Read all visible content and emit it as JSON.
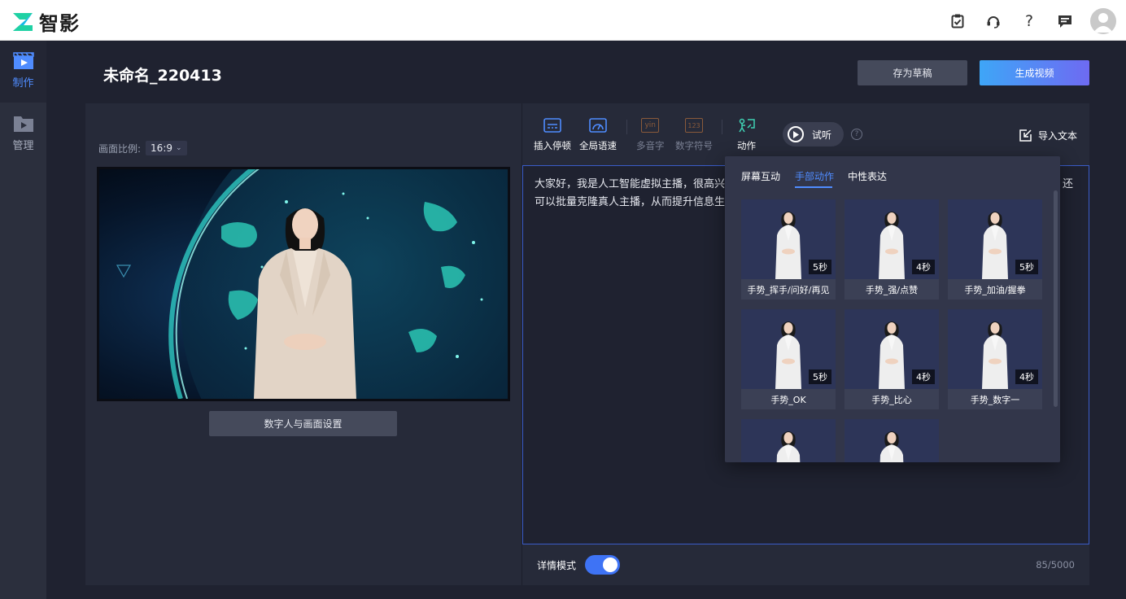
{
  "app": {
    "name": "智影"
  },
  "nav": {
    "items": [
      {
        "label": "制作",
        "icon": "film-clapper-icon",
        "active": true
      },
      {
        "label": "管理",
        "icon": "folder-video-icon",
        "active": false
      }
    ]
  },
  "header": {
    "title": "未命名_220413",
    "save_draft_label": "存为草稿",
    "generate_label": "生成视频"
  },
  "preview": {
    "ratio_label": "画面比例:",
    "ratio_value": "16:9",
    "settings_button_label": "数字人与画面设置"
  },
  "toolbar": {
    "tools": [
      {
        "label": "插入停顿",
        "icon": "insert-pause-icon",
        "enabled": true
      },
      {
        "label": "全局语速",
        "icon": "speed-gauge-icon",
        "enabled": true
      },
      {
        "label": "多音字",
        "icon": "polyphone-icon",
        "enabled": false,
        "icon_text": "yin"
      },
      {
        "label": "数字符号",
        "icon": "number-symbol-icon",
        "enabled": false,
        "icon_text": "123"
      },
      {
        "label": "动作",
        "icon": "action-icon",
        "enabled": true
      }
    ],
    "play_label": "试听",
    "import_label": "导入文本"
  },
  "editor": {
    "line1_visible": "大家好，我是人工智能虚拟主播，很高兴",
    "line1_tail": "还",
    "line2_visible": "可以批量克隆真人主播，从而提升信息生"
  },
  "bottom": {
    "detail_mode_label": "详情模式",
    "detail_mode_on": true,
    "counter": "85/5000"
  },
  "action_popover": {
    "tabs": [
      "屏幕互动",
      "手部动作",
      "中性表达"
    ],
    "active_tab": 1,
    "cards": [
      {
        "label": "手势_挥手/问好/再见",
        "duration": "5秒"
      },
      {
        "label": "手势_强/点赞",
        "duration": "4秒"
      },
      {
        "label": "手势_加油/握拳",
        "duration": "5秒"
      },
      {
        "label": "手势_OK",
        "duration": "5秒"
      },
      {
        "label": "手势_比心",
        "duration": "4秒"
      },
      {
        "label": "手势_数字一",
        "duration": "4秒",
        "selected": true
      },
      {
        "label": "",
        "duration": ""
      },
      {
        "label": "",
        "duration": ""
      }
    ]
  },
  "colors": {
    "accent": "#4f8cff",
    "toggle_on": "#3e73f5",
    "generate_gradient_start": "#3ea6f7",
    "generate_gradient_end": "#6e6af2"
  }
}
